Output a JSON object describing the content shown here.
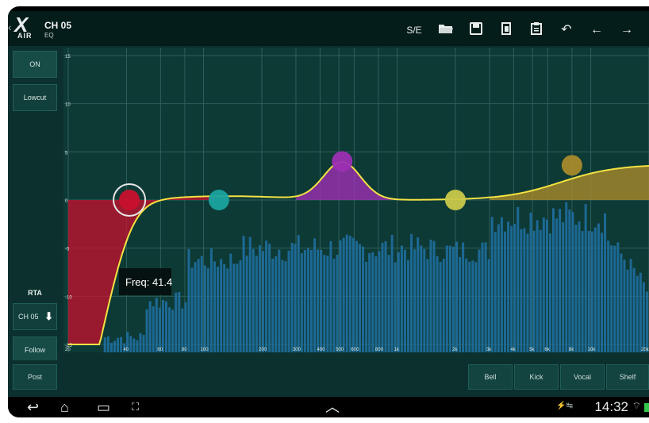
{
  "header": {
    "channel_title": "CH 05",
    "subtitle": "EQ",
    "logo_text": "AIR",
    "se_label": "S/E"
  },
  "toolbar_icons": [
    "folder-open-icon",
    "save-icon",
    "copy-icon",
    "paste-icon",
    "undo-icon",
    "arrow-left-icon",
    "arrow-right-icon"
  ],
  "left_panel": {
    "on_label": "ON",
    "lowcut_label": "Lowcut",
    "rta_label": "RTA",
    "rta_source": "CH 05",
    "follow_label": "Follow",
    "post_label": "Post"
  },
  "graph": {
    "y_ticks": [
      "15",
      "10",
      "5",
      "0",
      "-5",
      "-10",
      "-15"
    ],
    "x_ticks": [
      "20",
      "40",
      "60",
      "80",
      "100",
      "200",
      "300",
      "400",
      "500",
      "600",
      "800",
      "1k",
      "2k",
      "3k",
      "4k",
      "5k",
      "6k",
      "8k",
      "10k",
      "20k"
    ],
    "tooltip": "Freq: 41.4",
    "band_colors": {
      "lowcut": "#c8102e",
      "band1": "#1aa3a0",
      "band2": "#9c2fb3",
      "band3": "#c9c84a",
      "band4": "#a88a2c",
      "curve": "#f4e242",
      "rta": "#1f6fa0"
    }
  },
  "bottom_buttons": {
    "bell": "Bell",
    "kick": "Kick",
    "vocal": "Vocal",
    "shelf": "Shelf"
  },
  "statusbar": {
    "clock": "14:32"
  }
}
